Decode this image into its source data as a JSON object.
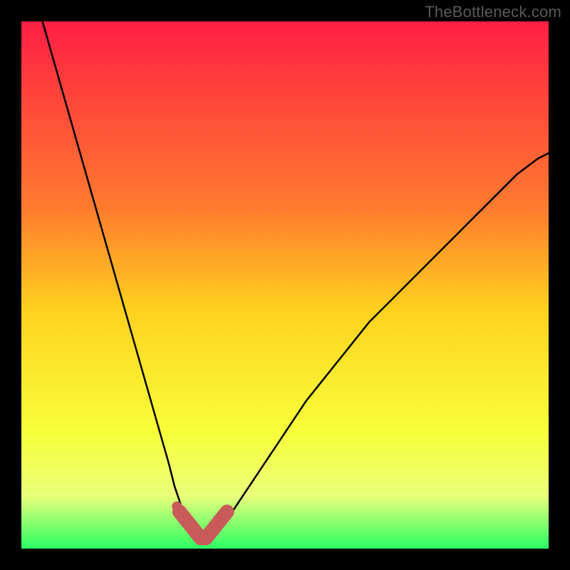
{
  "watermark": "TheBottleneck.com",
  "colors": {
    "gradient_top": "#ff1f44",
    "gradient_upper_mid": "#ff7a2e",
    "gradient_mid": "#ffd21f",
    "gradient_lower_mid": "#f7ff3a",
    "gradient_lower": "#eaff7a",
    "gradient_bottom": "#2bff63",
    "curve": "#000000",
    "marker_fill": "#c85a5a",
    "marker_stroke": "#c85a5a",
    "frame": "#000000"
  },
  "chart_data": {
    "type": "line",
    "title": "",
    "xlabel": "",
    "ylabel": "",
    "xlim": [
      0,
      100
    ],
    "ylim": [
      0,
      100
    ],
    "grid": false,
    "legend": false,
    "series": [
      {
        "name": "bottleneck-curve",
        "x": [
          4,
          6,
          8,
          10,
          12,
          14,
          16,
          18,
          20,
          22,
          24,
          26,
          28,
          29,
          30,
          31,
          32,
          33,
          34,
          35,
          36,
          37,
          38,
          40,
          42,
          44,
          46,
          48,
          50,
          54,
          58,
          62,
          66,
          70,
          74,
          78,
          82,
          86,
          90,
          94,
          98,
          100
        ],
        "y": [
          100,
          93,
          86,
          79,
          72,
          65,
          58,
          51,
          44,
          37,
          30,
          23,
          16,
          12,
          9,
          6,
          4,
          3,
          2,
          2,
          2,
          3,
          4,
          7,
          10,
          13,
          16,
          19,
          22,
          28,
          33,
          38,
          43,
          47,
          51,
          55,
          59,
          63,
          67,
          71,
          74,
          75
        ]
      }
    ],
    "markers": [
      {
        "name": "marker-dot",
        "x": 29.5,
        "y": 8
      },
      {
        "name": "marker-v-left",
        "x_range": [
          30,
          34
        ],
        "y_top": 7,
        "y_bottom": 2
      },
      {
        "name": "marker-v-right",
        "x_range": [
          35,
          39
        ],
        "y_top": 7,
        "y_bottom": 2
      }
    ]
  }
}
